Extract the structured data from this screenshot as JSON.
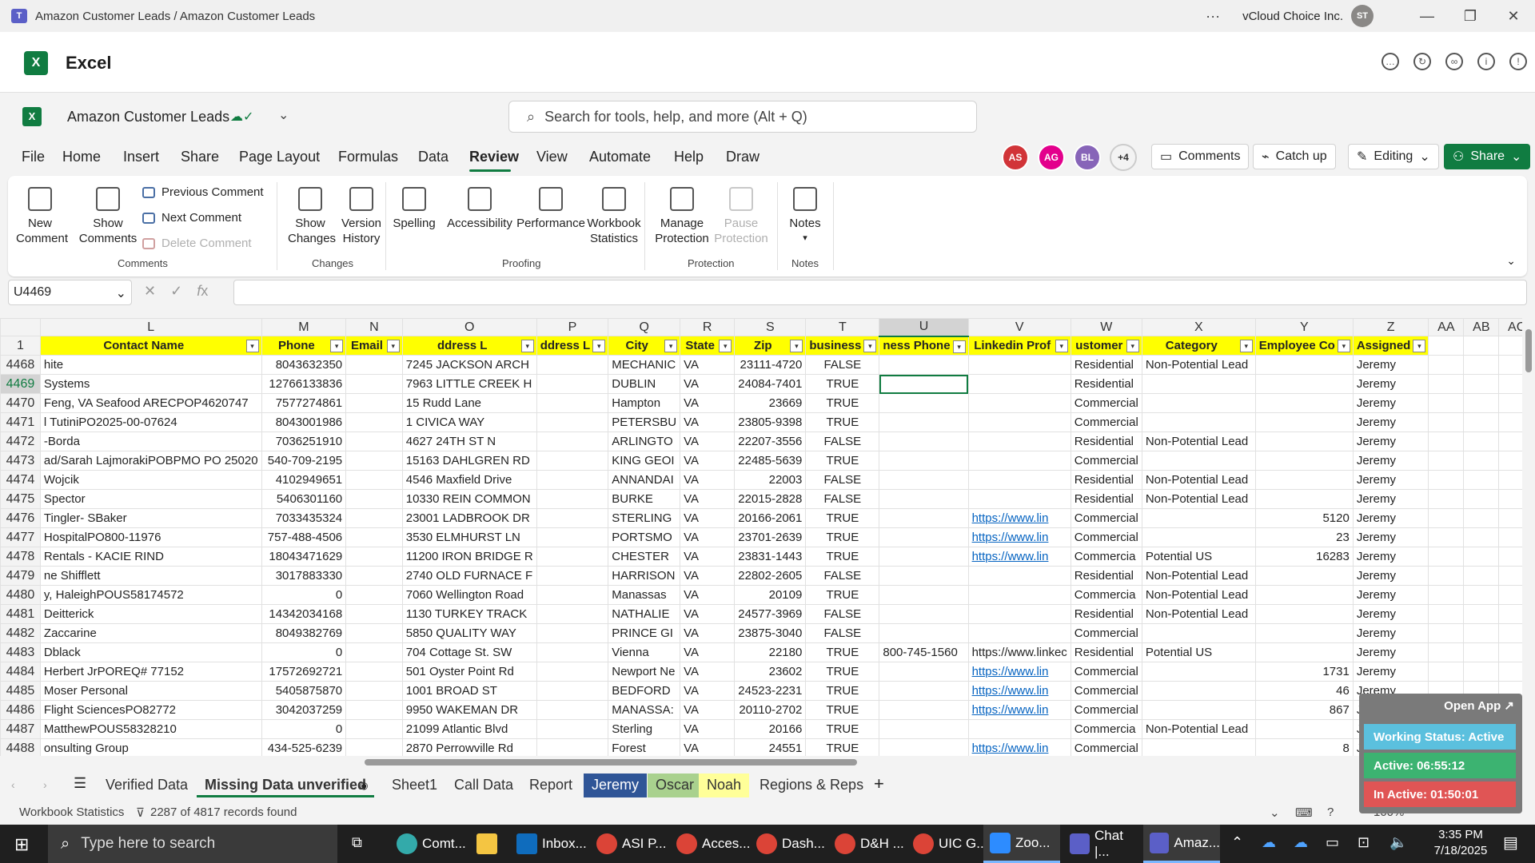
{
  "window": {
    "title": "Amazon Customer Leads / Amazon Customer Leads",
    "org": "vCloud Choice Inc.",
    "user_initials": "ST"
  },
  "app": {
    "name": "Excel"
  },
  "doc": {
    "name": "Amazon Customer Leads",
    "search_placeholder": "Search for tools, help, and more (Alt + Q)"
  },
  "menu": {
    "tabs": [
      "File",
      "Home",
      "Insert",
      "Share",
      "Page Layout",
      "Formulas",
      "Data",
      "Review",
      "View",
      "Automate",
      "Help",
      "Draw"
    ],
    "active": "Review"
  },
  "presence": [
    {
      "initials": "AS",
      "color": "#d13438"
    },
    {
      "initials": "AG",
      "color": "#e3008c"
    },
    {
      "initials": "BL",
      "color": "#8764b8"
    }
  ],
  "presence_more": "+4",
  "header_buttons": {
    "comments": "Comments",
    "catchup": "Catch up",
    "editing": "Editing",
    "share": "Share"
  },
  "ribbon": {
    "new_comment": "New Comment",
    "show_comments": "Show Comments",
    "previous_comment": "Previous Comment",
    "next_comment": "Next Comment",
    "delete_comment": "Delete Comment",
    "group_comments": "Comments",
    "show_changes": "Show Changes",
    "version_history": "Version History",
    "group_changes": "Changes",
    "spelling": "Spelling",
    "accessibility": "Accessibility",
    "performance": "Performance",
    "workbook_statistics": "Workbook Statistics",
    "group_proofing": "Proofing",
    "manage_protection": "Manage Protection",
    "pause_protection": "Pause Protection",
    "group_protection": "Protection",
    "notes": "Notes",
    "group_notes": "Notes"
  },
  "formula_bar": {
    "name_box": "U4469",
    "formula": ""
  },
  "grid": {
    "columns": [
      "L",
      "M",
      "N",
      "O",
      "P",
      "Q",
      "R",
      "S",
      "T",
      "U",
      "V",
      "W",
      "X",
      "Y",
      "Z",
      "AA",
      "AB",
      "AC"
    ],
    "selected_column": "U",
    "header_row_number": "1",
    "headers": [
      "Contact Name",
      "Phone",
      "Email",
      "ddress L",
      "ddress L",
      "City",
      "State",
      "Zip",
      "business",
      "ness Phone",
      "Linkedin Prof",
      "ustomer",
      "Category",
      "Employee Co",
      "Assigned",
      "",
      "",
      ""
    ],
    "selected_row": "4469",
    "rows": [
      {
        "n": "4468",
        "c": [
          "hite",
          "8043632350",
          "",
          "7245 JACKSON ARCH",
          "",
          "MECHANIC",
          "VA",
          "23111-4720",
          "FALSE",
          "",
          "",
          "Residential",
          "Non-Potential Lead",
          "",
          "Jeremy",
          "",
          "",
          ""
        ]
      },
      {
        "n": "4469",
        "c": [
          " Systems",
          "12766133836",
          "",
          "7963 LITTLE CREEK H",
          "",
          "DUBLIN",
          "VA",
          "24084-7401",
          "TRUE",
          "",
          "",
          "Residential",
          "",
          "",
          "Jeremy",
          "",
          "",
          ""
        ]
      },
      {
        "n": "4470",
        "c": [
          "Feng, VA Seafood ARECPOP4620747",
          "7577274861",
          "",
          "15 Rudd Lane",
          "",
          "Hampton",
          "VA",
          "23669",
          "TRUE",
          "",
          "",
          "Commercial",
          "",
          "",
          "Jeremy",
          "",
          "",
          ""
        ]
      },
      {
        "n": "4471",
        "c": [
          "l TutiniPO2025-00-07624",
          "8043001986",
          "",
          "1 CIVICA WAY",
          "",
          "PETERSBU",
          "VA",
          "23805-9398",
          "TRUE",
          "",
          "",
          "Commercial",
          "",
          "",
          "Jeremy",
          "",
          "",
          ""
        ]
      },
      {
        "n": "4472",
        "c": [
          "-Borda",
          "7036251910",
          "",
          "4627 24TH ST N",
          "",
          "ARLINGTO",
          "VA",
          "22207-3556",
          "FALSE",
          "",
          "",
          "Residential",
          "Non-Potential Lead",
          "",
          "Jeremy",
          "",
          "",
          ""
        ]
      },
      {
        "n": "4473",
        "c": [
          "ad/Sarah LajmorakiPOBPMO PO 25020",
          "540-709-2195",
          "",
          "15163 DAHLGREN RD",
          "",
          "KING GEOI",
          "VA",
          "22485-5639",
          "TRUE",
          "",
          "",
          "Commercial",
          "",
          "",
          "Jeremy",
          "",
          "",
          ""
        ]
      },
      {
        "n": "4474",
        "c": [
          " Wojcik",
          "4102949651",
          "",
          "4546 Maxfield Drive",
          "",
          "ANNANDAI",
          "VA",
          "22003",
          "FALSE",
          "",
          "",
          "Residential",
          "Non-Potential Lead",
          "",
          "Jeremy",
          "",
          "",
          ""
        ]
      },
      {
        "n": "4475",
        "c": [
          " Spector",
          "5406301160",
          "",
          "10330 REIN COMMON",
          "",
          "BURKE",
          "VA",
          "22015-2828",
          "FALSE",
          "",
          "",
          "Residential",
          "Non-Potential Lead",
          "",
          "Jeremy",
          "",
          "",
          ""
        ]
      },
      {
        "n": "4476",
        "c": [
          "Tingler- SBaker",
          "7033435324",
          "",
          "23001 LADBROOK DR",
          "",
          "STERLING",
          "VA",
          "20166-2061",
          "TRUE",
          "",
          "https://www.lin",
          "Commercial",
          "",
          "5120",
          "Jeremy",
          "",
          "",
          ""
        ]
      },
      {
        "n": "4477",
        "c": [
          " HospitalPO800-11976",
          "757-488-4506",
          "",
          "3530 ELMHURST LN",
          "",
          "PORTSMO",
          "VA",
          "23701-2639",
          "TRUE",
          "",
          "https://www.lin",
          "Commercial",
          "",
          "23",
          "Jeremy",
          "",
          "",
          ""
        ]
      },
      {
        "n": "4478",
        "c": [
          " Rentals - KACIE RIND",
          "18043471629",
          "",
          "11200 IRON BRIDGE R",
          "",
          "CHESTER",
          "VA",
          "23831-1443",
          "TRUE",
          "",
          "https://www.lin",
          "Commercia",
          "Potential US",
          "16283",
          "Jeremy",
          "",
          "",
          ""
        ]
      },
      {
        "n": "4479",
        "c": [
          "ne Shifflett",
          "3017883330",
          "",
          "2740 OLD FURNACE F",
          "",
          "HARRISON",
          "VA",
          "22802-2605",
          "FALSE",
          "",
          "",
          "Residential",
          "Non-Potential Lead",
          "",
          "Jeremy",
          "",
          "",
          ""
        ]
      },
      {
        "n": "4480",
        "c": [
          "y, HaleighPOUS58174572",
          "0",
          "",
          "7060 Wellington Road",
          "",
          "Manassas",
          "VA",
          "20109",
          "TRUE",
          "",
          "",
          "Commercia",
          "Non-Potential Lead",
          "",
          "Jeremy",
          "",
          "",
          ""
        ]
      },
      {
        "n": "4481",
        "c": [
          "Deitterick",
          "14342034168",
          "",
          "1130 TURKEY TRACK",
          "",
          "NATHALIE",
          "VA",
          "24577-3969",
          "FALSE",
          "",
          "",
          "Residential",
          "Non-Potential Lead",
          "",
          "Jeremy",
          "",
          "",
          ""
        ]
      },
      {
        "n": "4482",
        "c": [
          " Zaccarine",
          "8049382769",
          "",
          "5850 QUALITY WAY",
          "",
          "PRINCE GI",
          "VA",
          "23875-3040",
          "FALSE",
          "",
          "",
          "Commercial",
          "",
          "",
          "Jeremy",
          "",
          "",
          ""
        ]
      },
      {
        "n": "4483",
        "c": [
          "Dblack",
          "0",
          "",
          "704 Cottage St. SW",
          "",
          "Vienna",
          "VA",
          "22180",
          "TRUE",
          "800-745-1560",
          "https://www.linkec",
          "Residential",
          "Potential US",
          "",
          "Jeremy",
          "",
          "",
          ""
        ]
      },
      {
        "n": "4484",
        "c": [
          " Herbert JrPOREQ# 77152",
          "17572692721",
          "",
          "501 Oyster Point Rd",
          "",
          "Newport Ne",
          "VA",
          "23602",
          "TRUE",
          "",
          "https://www.lin",
          "Commercial",
          "",
          "1731",
          "Jeremy",
          "",
          "",
          ""
        ]
      },
      {
        "n": "4485",
        "c": [
          "Moser Personal",
          "5405875870",
          "",
          "1001 BROAD ST",
          "",
          "BEDFORD",
          "VA",
          "24523-2231",
          "TRUE",
          "",
          "https://www.lin",
          "Commercial",
          "",
          "46",
          "Jeremy",
          "",
          "",
          ""
        ]
      },
      {
        "n": "4486",
        "c": [
          " Flight SciencesPO82772",
          "3042037259",
          "",
          "9950 WAKEMAN DR",
          "",
          "MANASSA:",
          "VA",
          "20110-2702",
          "TRUE",
          "",
          "https://www.lin",
          "Commercial",
          "",
          "867",
          "Jeremy",
          "",
          "",
          ""
        ]
      },
      {
        "n": "4487",
        "c": [
          " MatthewPOUS58328210",
          "0",
          "",
          "21099 Atlantic Blvd",
          "",
          "Sterling",
          "VA",
          "20166",
          "TRUE",
          "",
          "",
          "Commercia",
          "Non-Potential Lead",
          "",
          "Jeremy",
          "",
          "",
          ""
        ]
      },
      {
        "n": "4488",
        "c": [
          "onsulting Group",
          "434-525-6239",
          "",
          "2870 Perrowville Rd",
          "",
          "Forest",
          "VA",
          "24551",
          "TRUE",
          "",
          "https://www.lin",
          "Commercial",
          "",
          "8",
          "Jeremy",
          "",
          "",
          ""
        ]
      }
    ]
  },
  "sheets": [
    {
      "name": "Verified Data",
      "color": ""
    },
    {
      "name": "Missing Data unverified",
      "color": "",
      "active": true
    },
    {
      "name": "Sheet1",
      "color": ""
    },
    {
      "name": "Call Data",
      "color": ""
    },
    {
      "name": "Report",
      "color": ""
    },
    {
      "name": "Jeremy",
      "color": "#2f5597"
    },
    {
      "name": "Oscar",
      "color": "#a9d18e"
    },
    {
      "name": "Noah",
      "color": "#ffff99"
    },
    {
      "name": "Regions & Reps",
      "color": ""
    }
  ],
  "status": {
    "left": "Workbook Statistics",
    "filter": "2287 of 4817 records found",
    "zoom": "100%"
  },
  "widget": {
    "open_app": "Open App ↗",
    "working_status": "Working Status: Active",
    "active": "Active: 06:55:12",
    "inactive": "In Active: 01:50:01"
  },
  "taskbar": {
    "search_placeholder": "Type here to search",
    "apps": [
      "Comt...",
      "Inbox...",
      "ASI P...",
      "Acces...",
      "Dash...",
      "D&H ...",
      "UIC G...",
      "Zoo...",
      "Chat |...",
      "Amaz..."
    ],
    "time": "3:35 PM",
    "date": "7/18/2025"
  }
}
